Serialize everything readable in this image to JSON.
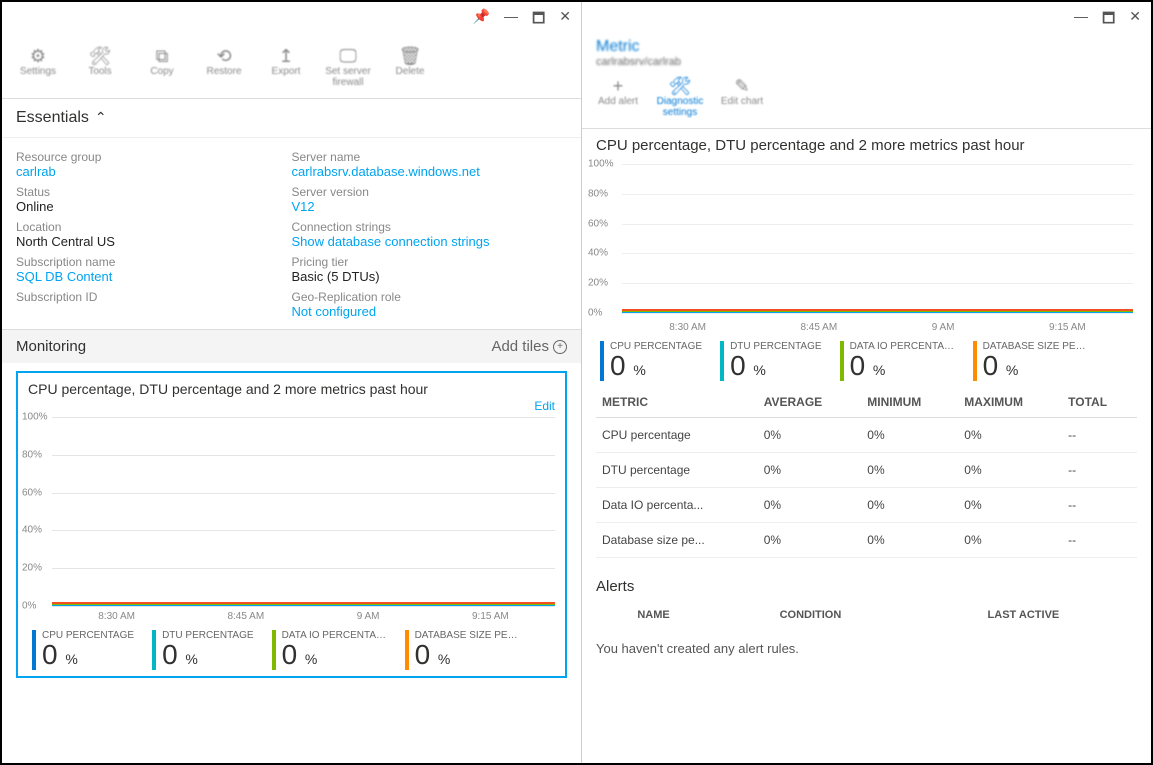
{
  "left_win": {
    "pin": "📌",
    "min": "—",
    "max": "🗖",
    "close": "✕"
  },
  "right_win": {
    "min": "—",
    "max": "🗖",
    "close": "✕"
  },
  "right_header": {
    "title": "Metric",
    "sub": "carlrabsrv/carlrab"
  },
  "toolbar_left": [
    {
      "icon": "⚙",
      "label": "Settings"
    },
    {
      "icon": "🛠",
      "label": "Tools"
    },
    {
      "icon": "⧉",
      "label": "Copy"
    },
    {
      "icon": "⟲",
      "label": "Restore"
    },
    {
      "icon": "↥",
      "label": "Export"
    },
    {
      "icon": "🖵",
      "label": "Set server firewall"
    },
    {
      "icon": "🗑",
      "label": "Delete"
    }
  ],
  "toolbar_right": [
    {
      "icon": "+",
      "label": "Add alert",
      "sel": false
    },
    {
      "icon": "🛠",
      "label": "Diagnostic settings",
      "sel": true
    },
    {
      "icon": "✎",
      "label": "Edit chart",
      "sel": false
    }
  ],
  "essentials": {
    "header": "Essentials",
    "left": [
      {
        "label": "Resource group",
        "value": "carlrab",
        "link": true
      },
      {
        "label": "Status",
        "value": "Online"
      },
      {
        "label": "Location",
        "value": "North Central US"
      },
      {
        "label": "Subscription name",
        "value": "SQL DB Content",
        "link": true
      },
      {
        "label": "Subscription ID",
        "value": ""
      }
    ],
    "right": [
      {
        "label": "Server name",
        "value": "carlrabsrv.database.windows.net",
        "link": true
      },
      {
        "label": "Server version",
        "value": "V12",
        "link": true
      },
      {
        "label": "Connection strings",
        "value": "Show database connection strings",
        "link": true
      },
      {
        "label": "Pricing tier",
        "value": "Basic (5 DTUs)"
      },
      {
        "label": "Geo-Replication role",
        "value": "Not configured",
        "link": true
      }
    ]
  },
  "monitoring": {
    "header": "Monitoring",
    "add_tiles": "Add tiles"
  },
  "chart": {
    "title": "CPU percentage, DTU percentage and 2 more metrics past hour",
    "edit": "Edit",
    "yticks": [
      "100%",
      "80%",
      "60%",
      "40%",
      "20%",
      "0%"
    ],
    "xticks": [
      "8:30 AM",
      "8:45 AM",
      "9 AM",
      "9:15 AM"
    ],
    "legend": [
      {
        "name": "CPU PERCENTAGE",
        "val": "0",
        "color": "c-blue"
      },
      {
        "name": "DTU PERCENTAGE",
        "val": "0",
        "color": "c-cyan"
      },
      {
        "name": "DATA IO PERCENTAGE",
        "val": "0",
        "color": "c-green"
      },
      {
        "name": "DATABASE SIZE PERCENT...",
        "val": "0",
        "color": "c-orange"
      }
    ]
  },
  "chart_data": {
    "type": "line",
    "title": "CPU percentage, DTU percentage and 2 more metrics past hour",
    "xlabel": "",
    "ylabel": "%",
    "ylim": [
      0,
      100
    ],
    "x": [
      "8:30 AM",
      "8:45 AM",
      "9 AM",
      "9:15 AM"
    ],
    "series": [
      {
        "name": "CPU PERCENTAGE",
        "values": [
          0,
          0,
          0,
          0
        ]
      },
      {
        "name": "DTU PERCENTAGE",
        "values": [
          0,
          0,
          0,
          0
        ]
      },
      {
        "name": "DATA IO PERCENTAGE",
        "values": [
          0,
          0,
          0,
          0
        ]
      },
      {
        "name": "DATABASE SIZE PERCENTAGE",
        "values": [
          0,
          0,
          0,
          0
        ]
      }
    ]
  },
  "metrics_table": {
    "headers": [
      "METRIC",
      "AVERAGE",
      "MINIMUM",
      "MAXIMUM",
      "TOTAL"
    ],
    "rows": [
      [
        "CPU percentage",
        "0%",
        "0%",
        "0%",
        "--"
      ],
      [
        "DTU percentage",
        "0%",
        "0%",
        "0%",
        "--"
      ],
      [
        "Data IO percenta...",
        "0%",
        "0%",
        "0%",
        "--"
      ],
      [
        "Database size pe...",
        "0%",
        "0%",
        "0%",
        "--"
      ]
    ]
  },
  "alerts": {
    "header": "Alerts",
    "columns": [
      "NAME",
      "CONDITION",
      "LAST ACTIVE"
    ],
    "empty": "You haven't created any alert rules."
  }
}
